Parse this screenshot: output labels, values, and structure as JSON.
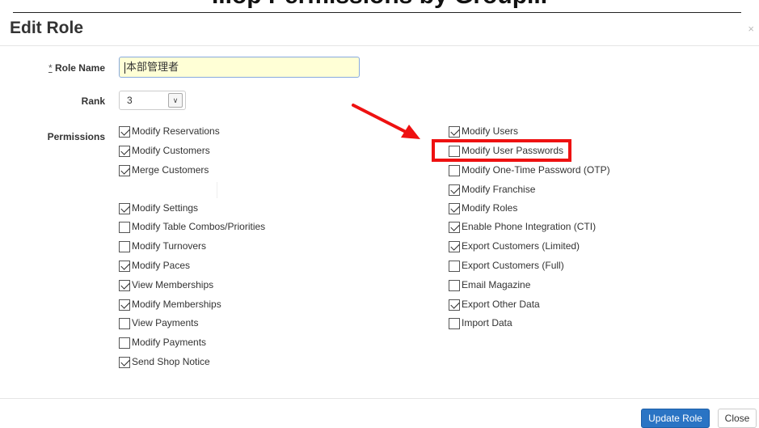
{
  "top_banner_text": "...op Permissions by Group...",
  "modal": {
    "title": "Edit Role",
    "close_glyph": "×"
  },
  "form": {
    "role_name_required_mark": "*",
    "role_name_label": "Role Name",
    "role_name_value": "本部管理者",
    "rank_label": "Rank",
    "rank_value": "3",
    "permissions_label": "Permissions"
  },
  "permissions_left": [
    {
      "label": "Modify Reservations",
      "checked": true
    },
    {
      "label": "Modify Customers",
      "checked": true
    },
    {
      "label": "Merge Customers",
      "checked": true
    },
    {
      "label": "Modify Settings",
      "checked": true
    },
    {
      "label": "Modify Table Combos/Priorities",
      "checked": false
    },
    {
      "label": "Modify Turnovers",
      "checked": false
    },
    {
      "label": "Modify Paces",
      "checked": true
    },
    {
      "label": "View Memberships",
      "checked": true
    },
    {
      "label": "Modify Memberships",
      "checked": true
    },
    {
      "label": "View Payments",
      "checked": false
    },
    {
      "label": "Modify Payments",
      "checked": false
    },
    {
      "label": "Send Shop Notice",
      "checked": true
    }
  ],
  "permissions_right": [
    {
      "label": "Modify Users",
      "checked": true
    },
    {
      "label": "Modify User Passwords",
      "checked": false
    },
    {
      "label": "Modify One-Time Password (OTP)",
      "checked": false
    },
    {
      "label": "Modify Franchise",
      "checked": true
    },
    {
      "label": "Modify Roles",
      "checked": true
    },
    {
      "label": "Enable Phone Integration (CTI)",
      "checked": true
    },
    {
      "label": "Export Customers (Limited)",
      "checked": true
    },
    {
      "label": "Export Customers (Full)",
      "checked": false
    },
    {
      "label": "Email Magazine",
      "checked": false
    },
    {
      "label": "Export Other Data",
      "checked": true
    },
    {
      "label": "Import Data",
      "checked": false
    }
  ],
  "footer": {
    "update_label": "Update Role",
    "close_label": "Close"
  },
  "colors": {
    "primary_button": "#2a74c4",
    "annotation_red": "#ee1111",
    "input_highlight": "#ffffd6"
  }
}
